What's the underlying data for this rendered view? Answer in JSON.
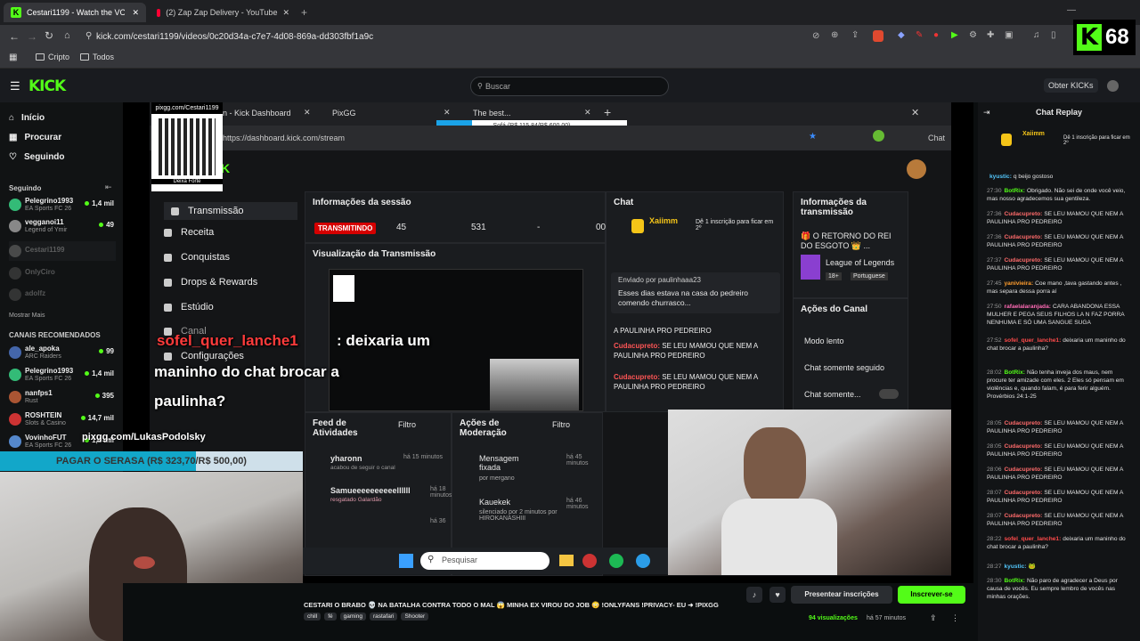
{
  "browser": {
    "tabs": [
      {
        "label": "Cestari1199 - Watch the VOD"
      },
      {
        "label": "(2) Zap Zap Delivery - YouTube"
      }
    ],
    "url": "kick.com/cestari1199/videos/0c20d34a-c7e7-4d08-869a-dd303fbf1a9c",
    "bookmarks": [
      "Cripto",
      "Todos"
    ],
    "kick_points": "68"
  },
  "header": {
    "logo": "KICK",
    "search_placeholder": "Buscar",
    "get_kicks": "Obter KICKs"
  },
  "sidebar": {
    "nav": [
      "Início",
      "Procurar",
      "Seguindo"
    ],
    "following_title": "Seguindo",
    "following": [
      {
        "name": "Pelegrino1993",
        "game": "EA Sports FC 26",
        "viewers": "1,4 mil"
      },
      {
        "name": "vegganoi11",
        "game": "Legend of Ymir",
        "viewers": "49"
      },
      {
        "name": "Cestari1199",
        "game": "",
        "viewers": ""
      },
      {
        "name": "OnlyCiro",
        "game": "",
        "viewers": ""
      },
      {
        "name": "adolfz",
        "game": "",
        "viewers": ""
      }
    ],
    "show_more": "Mostrar Mais",
    "recommended_title": "CANAIS RECOMENDADOS",
    "recommended": [
      {
        "name": "ale_apoka",
        "game": "ARC Raiders",
        "viewers": "99"
      },
      {
        "name": "Pelegrino1993",
        "game": "EA Sports FC 26",
        "viewers": "1,4 mil"
      },
      {
        "name": "nanfps1",
        "game": "Rust",
        "viewers": "395"
      },
      {
        "name": "ROSHTEIN",
        "game": "Slots & Casino",
        "viewers": "14,7 mil"
      },
      {
        "name": "VovinhoFUT",
        "game": "EA Sports FC 26",
        "viewers": "1,4 mil"
      }
    ]
  },
  "video": {
    "qr_label": "pixgg.com/Cestari1199",
    "qr_sub": "Deixa Forte",
    "inner_tabs": [
      "n - Kick Dashboard",
      "PixGG",
      "The best..."
    ],
    "inner_tab_overlay": "Sofá (R$ 115,84/R$ 600,00)",
    "inner_url": "https://dashboard.kick.com/stream",
    "inner_chat_btn": "Chat",
    "dash_nav": [
      "Transmissão",
      "Receita",
      "Conquistas",
      "Drops & Rewards",
      "Estúdio",
      "Canal",
      "Configurações"
    ],
    "session": {
      "title": "Informações da sessão",
      "live": "TRANSMITINDO",
      "followers": "45",
      "views": "531",
      "dash": "-",
      "time": "00"
    },
    "preview_title": "Visualização da Transmissão",
    "chat_panel": {
      "title": "Chat",
      "sub_user": "Xaiimm",
      "sub_text": "Dê 1 inscrição para ficar em 2º",
      "pinned_label": "Enviado por paulinhaaa23",
      "pinned_text": "Esses dias estava na casa do pedreiro comendo churrasco...",
      "lines": [
        {
          "user": "",
          "text": "A PAULINHA PRO PEDREIRO"
        },
        {
          "user": "Cudacupreto:",
          "text": "SE LEU MAMOU QUE NEM A PAULINHA PRO PEDREIRO"
        },
        {
          "user": "Cudacupreto:",
          "text": "SE LEU MAMOU QUE NEM A PAULINHA PRO PEDREIRO"
        }
      ],
      "send": "Envi"
    },
    "info_panel": {
      "title": "Informações da transmissão",
      "stream_title": "🎁 O RETORNO DO REI DO ESGOTO 👑 ...",
      "game": "League of Legends",
      "age": "18+",
      "lang": "Portuguese"
    },
    "actions_panel": {
      "title": "Ações do Canal",
      "items": [
        "Modo lento",
        "Chat somente seguido",
        "Chat somente..."
      ]
    },
    "feed": {
      "title": "Feed de Atividades",
      "filter": "Filtro",
      "items": [
        {
          "user": "yharonn",
          "sub": "acabou de seguir o canal",
          "time": "há 15 minutos"
        },
        {
          "user": "Samueeeeeeeeeellllll",
          "sub": "resgatado Galardão",
          "time": "há 18 minutos"
        },
        {
          "user": "",
          "sub": "",
          "time": "há 36"
        }
      ]
    },
    "mod": {
      "title": "Ações de Moderação",
      "filter": "Filtro",
      "items": [
        {
          "user": "Mensagem fixada",
          "sub": "por mergano",
          "time": "há 45 minutos"
        },
        {
          "user": "Kauekek",
          "sub": "silenciado por 2 minutos por HIROKANASHIII",
          "time": "há 46 minutos"
        }
      ]
    },
    "overlay_user": "sofel_quer_lanche1",
    "overlay_text1": ": deixaria um",
    "overlay_text2": "maninho do chat brocar a",
    "overlay_text3": "paulinha?",
    "pix_url": "pixgg.com/LukasPodolsky",
    "serasa": "PAGAR O SERASA (R$ 323,70/R$ 500,00)",
    "serasa_progress": 0.647,
    "taskbar_search": "Pesquisar"
  },
  "stream": {
    "title": "CESTARI O BRABO 💀 NA BATALHA CONTRA TODO O MAL 😱 MINHA EX VIROU DO JOB 😳 !ONLYFANS !PRIVACY- EU ➜ !PIXGG",
    "tags": [
      "chill",
      "fé",
      "gaming",
      "rastafari",
      "Shooter"
    ],
    "viewers": "94 visualizações",
    "ago": "há 57 minutos",
    "gift_btn": "Presentear inscrições",
    "sub_btn": "Inscrever-se"
  },
  "chat": {
    "title": "Chat Replay",
    "top_user": "Xaiimm",
    "top_text": "Dê 1 inscrição para ficar em 2º",
    "messages": [
      {
        "t": "",
        "u": "kyustic:",
        "text": "q beijo gostoso",
        "c": "#53c7fc"
      },
      {
        "t": "27:30",
        "u": "BotRix:",
        "text": "Obrigado. Não sei de onde você veio, mas nosso agradecemos sua gentileza.",
        "c": "#53fc18"
      },
      {
        "t": "27:36",
        "u": "Cudacupreto:",
        "text": "SE LEU MAMOU QUE NEM A PAULINHA PRO PEDREIRO",
        "c": "#ff6b6b"
      },
      {
        "t": "27:36",
        "u": "Cudacupreto:",
        "text": "SE LEU MAMOU QUE NEM A PAULINHA PRO PEDREIRO",
        "c": "#ff6b6b"
      },
      {
        "t": "27:37",
        "u": "Cudacupreto:",
        "text": "SE LEU MAMOU QUE NEM A PAULINHA PRO PEDREIRO",
        "c": "#ff6b6b"
      },
      {
        "t": "27:45",
        "u": "yanivieira:",
        "text": "Coe mano ,tava gastando antes , mas separa dessa porra aí",
        "c": "#ff9d2e"
      },
      {
        "t": "27:50",
        "u": "rafaelalaranjada:",
        "text": "CARA ABANDONA ESSA MULHER E PEGA SEUS FILHOS LA N FAZ PORRA NENHUMA E SÓ UMA SANGUE SUGA",
        "c": "#ff6bb5"
      },
      {
        "t": "27:52",
        "u": "sofel_quer_lanche1:",
        "text": "deixaria um maninho do chat brocar a paulinha?",
        "c": "#ff4b4b"
      },
      {
        "t": "28:02",
        "u": "BotRix:",
        "text": "Não tenha inveja dos maus, nem procure ter amizade com eles. 2 Eles só pensam em violências e, quando falam, é para ferir alguém. Provérbios 24:1-25",
        "c": "#53fc18"
      },
      {
        "t": "28:05",
        "u": "Cudacupreto:",
        "text": "SE LEU MAMOU QUE NEM A PAULINHA PRO PEDREIRO",
        "c": "#ff6b6b"
      },
      {
        "t": "28:05",
        "u": "Cudacupreto:",
        "text": "SE LEU MAMOU QUE NEM A PAULINHA PRO PEDREIRO",
        "c": "#ff6b6b"
      },
      {
        "t": "28:06",
        "u": "Cudacupreto:",
        "text": "SE LEU MAMOU QUE NEM A PAULINHA PRO PEDREIRO",
        "c": "#ff6b6b"
      },
      {
        "t": "28:07",
        "u": "Cudacupreto:",
        "text": "SE LEU MAMOU QUE NEM A PAULINHA PRO PEDREIRO",
        "c": "#ff6b6b"
      },
      {
        "t": "28:07",
        "u": "Cudacupreto:",
        "text": "SE LEU MAMOU QUE NEM A PAULINHA PRO PEDREIRO",
        "c": "#ff6b6b"
      },
      {
        "t": "28:22",
        "u": "sofel_quer_lanche1:",
        "text": "deixaria um maninho do chat brocar a paulinha?",
        "c": "#ff4b4b"
      },
      {
        "t": "28:27",
        "u": "kyustic:",
        "text": "🐸",
        "c": "#53c7fc"
      },
      {
        "t": "28:30",
        "u": "BotRix:",
        "text": "Não paro de agradecer a Deus por causa de vocês. Eu sempre lembro de vocês nas minhas orações.",
        "c": "#53fc18"
      }
    ]
  }
}
